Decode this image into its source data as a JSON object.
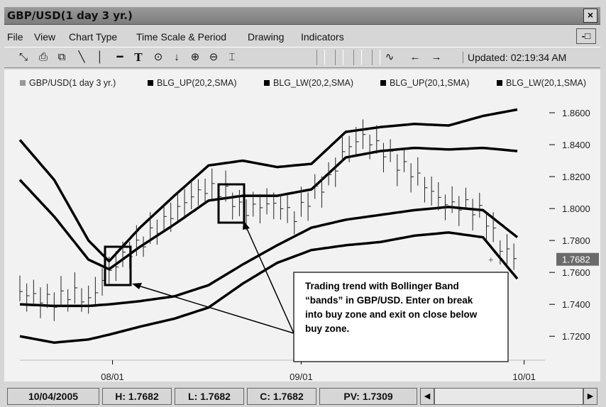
{
  "window": {
    "title": "GBP/USD(1 day  3 yr.)",
    "close_label": "×",
    "restore_label": "-□"
  },
  "menu": [
    "File",
    "View",
    "Chart Type",
    "Time Scale & Period",
    "Drawing",
    "Indicators"
  ],
  "toolbar": {
    "icons": [
      "line-tool-icon",
      "print-icon",
      "copy-icon",
      "trend-line-icon",
      "vertical-line-icon",
      "horizontal-line-icon",
      "text-tool-icon",
      "circle-tool-icon",
      "arrow-down-icon",
      "zoom-in-icon",
      "zoom-out-icon",
      "fit-icon"
    ],
    "nav_icons": [
      "wave-icon",
      "arrow-left-icon",
      "arrow-right-icon"
    ],
    "updated": "Updated: 02:19:34 AM"
  },
  "legend": [
    {
      "label": "GBP/USD(1 day  3 yr.)",
      "color": "#999999"
    },
    {
      "label": "BLG_UP(20,2,SMA)",
      "color": "#000000"
    },
    {
      "label": "BLG_LW(20,2,SMA)",
      "color": "#000000"
    },
    {
      "label": "BLG_UP(20,1,SMA)",
      "color": "#000000"
    },
    {
      "label": "BLG_LW(20,1,SMA)",
      "color": "#000000"
    }
  ],
  "chart_data": {
    "type": "line",
    "title": "",
    "ylim": [
      1.705,
      1.872
    ],
    "yticks": [
      "1.8600",
      "1.8400",
      "1.8200",
      "1.8000",
      "1.7800",
      "1.7600",
      "1.7400",
      "1.7200"
    ],
    "yticks_values": [
      1.86,
      1.84,
      1.82,
      1.8,
      1.78,
      1.76,
      1.74,
      1.72
    ],
    "xticks": [
      "08/01",
      "09/01",
      "10/01"
    ],
    "xticks_index": [
      27,
      82,
      147
    ],
    "last_value_label": "1.7682",
    "last_value": 1.7682,
    "n": 152,
    "series": [
      {
        "name": "BLG_UP(20,2,SMA)",
        "x": [
          0,
          10,
          20,
          26,
          35,
          45,
          55,
          65,
          75,
          85,
          95,
          105,
          115,
          125,
          135,
          145
        ],
        "values": [
          1.843,
          1.818,
          1.78,
          1.767,
          1.788,
          1.808,
          1.827,
          1.83,
          1.826,
          1.828,
          1.848,
          1.851,
          1.853,
          1.852,
          1.858,
          1.862
        ]
      },
      {
        "name": "BLG_UP(20,1,SMA)",
        "x": [
          0,
          10,
          20,
          26,
          35,
          45,
          55,
          65,
          75,
          85,
          95,
          105,
          115,
          125,
          135,
          145
        ],
        "values": [
          1.818,
          1.795,
          1.768,
          1.762,
          1.776,
          1.79,
          1.805,
          1.808,
          1.808,
          1.812,
          1.832,
          1.836,
          1.838,
          1.837,
          1.838,
          1.836
        ]
      },
      {
        "name": "BLG_LW(20,1,SMA)",
        "x": [
          0,
          10,
          20,
          26,
          35,
          45,
          55,
          65,
          75,
          85,
          95,
          105,
          115,
          125,
          135,
          145
        ],
        "values": [
          1.74,
          1.739,
          1.739,
          1.74,
          1.742,
          1.745,
          1.752,
          1.765,
          1.777,
          1.788,
          1.793,
          1.796,
          1.799,
          1.801,
          1.799,
          1.782
        ]
      },
      {
        "name": "BLG_LW(20,2,SMA)",
        "x": [
          0,
          10,
          20,
          26,
          35,
          45,
          55,
          65,
          75,
          85,
          95,
          105,
          115,
          125,
          135,
          145
        ],
        "values": [
          1.72,
          1.716,
          1.718,
          1.721,
          1.726,
          1.731,
          1.738,
          1.753,
          1.766,
          1.774,
          1.777,
          1.779,
          1.783,
          1.785,
          1.782,
          1.756
        ]
      },
      {
        "name": "GBP/USD(1 day  3 yr.)",
        "style": "hlc-bars",
        "x": [
          0,
          5,
          10,
          15,
          20,
          25,
          30,
          35,
          40,
          45,
          50,
          55,
          60,
          65,
          70,
          75,
          80,
          85,
          90,
          95,
          100,
          105,
          110,
          115,
          120,
          125,
          130,
          135,
          140,
          145
        ],
        "values": [
          1.748,
          1.744,
          1.742,
          1.748,
          1.742,
          1.758,
          1.77,
          1.778,
          1.788,
          1.798,
          1.808,
          1.813,
          1.81,
          1.798,
          1.802,
          1.803,
          1.795,
          1.808,
          1.818,
          1.838,
          1.845,
          1.838,
          1.828,
          1.822,
          1.81,
          1.802,
          1.802,
          1.797,
          1.776,
          1.768
        ]
      }
    ],
    "annotation": "Trading trend with Bollinger Band “bands” in GBP/USD. Enter on break into buy zone and exit on close below buy zone."
  },
  "status": {
    "date": "10/04/2005",
    "high": "H: 1.7682",
    "low": "L: 1.7682",
    "close": "C: 1.7682",
    "pv": "PV: 1.7309",
    "scroll_left": "◀",
    "scroll_right": "▶"
  }
}
